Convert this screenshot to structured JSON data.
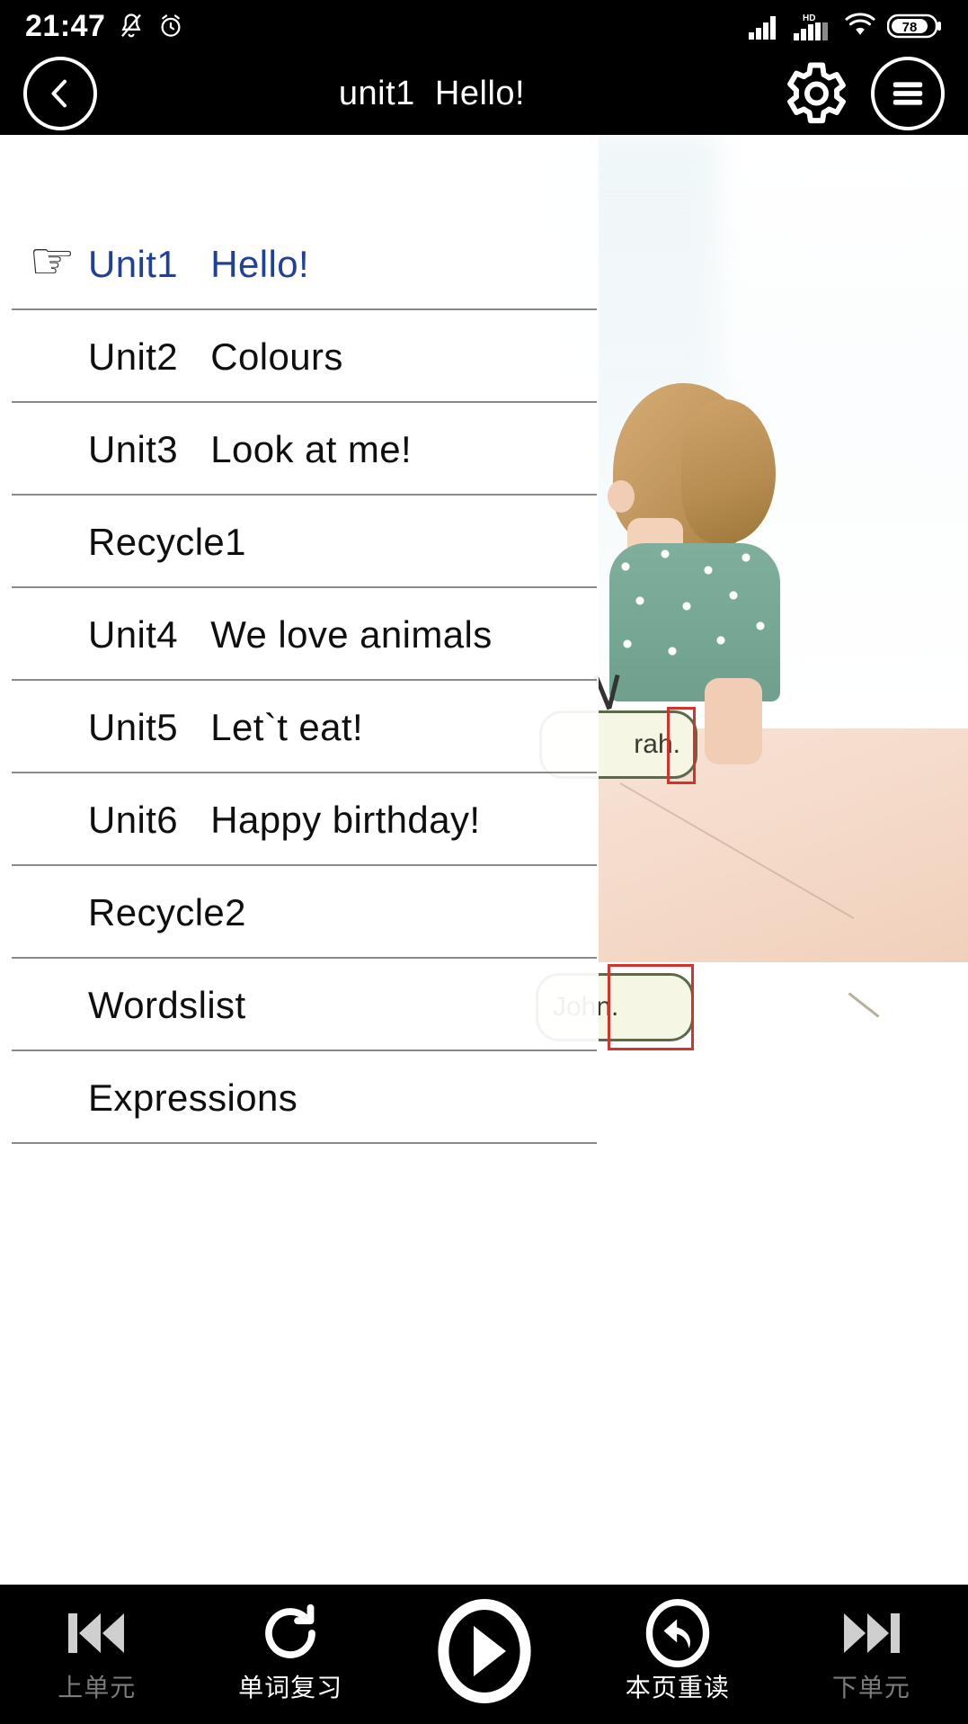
{
  "status_bar": {
    "time": "21:47",
    "icons": [
      "bell-muted-icon",
      "alarm-clock-icon",
      "signal-bars-icon",
      "hd-signal-icon",
      "wifi-icon",
      "battery-icon"
    ],
    "hd_label": "HD",
    "battery_percent": "78"
  },
  "header": {
    "back_icon": "chevron-left-icon",
    "title": "unit1  Hello!",
    "settings_icon": "gear-icon",
    "menu_icon": "hamburger-menu-icon"
  },
  "unit_list": {
    "pointer_icon": "pointing-hand-icon",
    "pointer_glyph": "☞",
    "active_color": "#21409a",
    "items": [
      {
        "label": "Unit1   Hello!",
        "active": true,
        "pointer": true
      },
      {
        "label": "Unit2   Colours",
        "active": false,
        "pointer": false
      },
      {
        "label": "Unit3   Look at me!",
        "active": false,
        "pointer": false
      },
      {
        "label": "Recycle1",
        "active": false,
        "pointer": false
      },
      {
        "label": "Unit4   We love animals",
        "active": false,
        "pointer": false
      },
      {
        "label": "Unit5   Let`t eat!",
        "active": false,
        "pointer": false
      },
      {
        "label": "Unit6   Happy birthday!",
        "active": false,
        "pointer": false
      },
      {
        "label": "Recycle2",
        "active": false,
        "pointer": false
      },
      {
        "label": "Wordslist",
        "active": false,
        "pointer": false
      },
      {
        "label": "Expressions",
        "active": false,
        "pointer": false
      }
    ]
  },
  "background_page": {
    "speech_bubble_1": "rah.",
    "speech_bubble_2": "John.",
    "highlight_color": "#d0342c"
  },
  "bottom_bar": {
    "items": [
      {
        "label": "上单元",
        "icon": "skip-previous-icon",
        "dim": true
      },
      {
        "label": "单词复习",
        "icon": "word-review-refresh-icon",
        "dim": false
      },
      {
        "label": "",
        "icon": "play-icon",
        "dim": false
      },
      {
        "label": "本页重读",
        "icon": "replay-page-icon",
        "dim": false
      },
      {
        "label": "下单元",
        "icon": "skip-next-icon",
        "dim": true
      }
    ]
  }
}
